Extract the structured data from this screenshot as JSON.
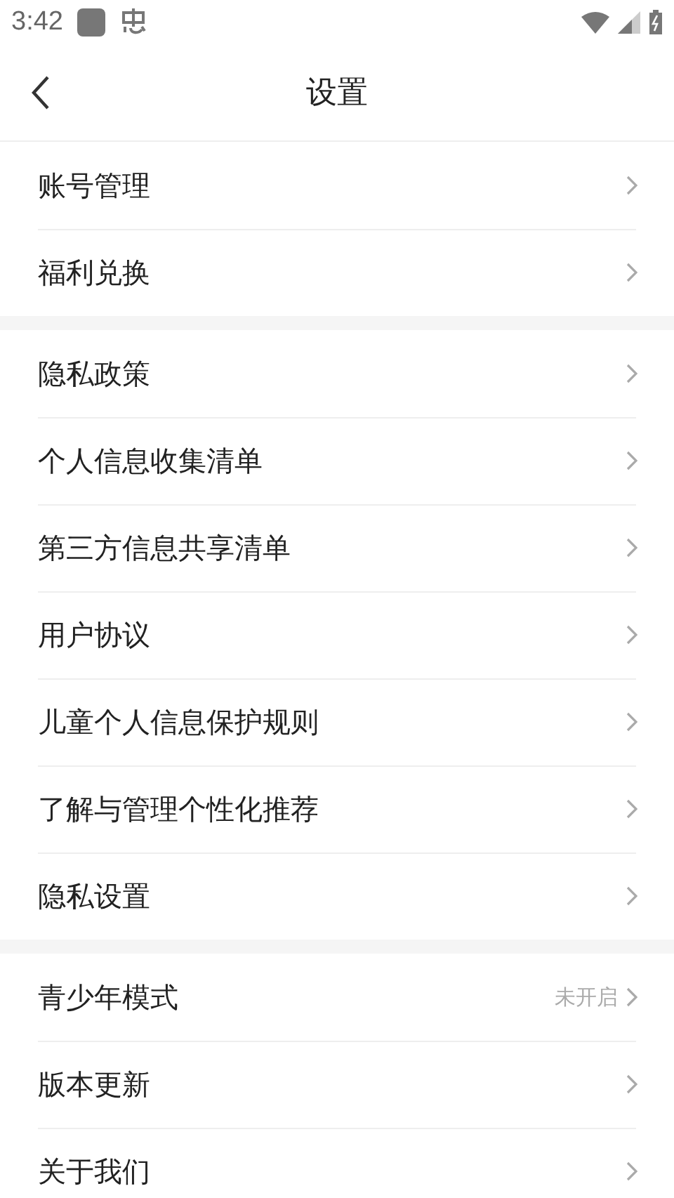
{
  "status_bar": {
    "time": "3:42"
  },
  "header": {
    "title": "设置"
  },
  "groups": [
    {
      "items": [
        {
          "label": "账号管理"
        },
        {
          "label": "福利兑换"
        }
      ]
    },
    {
      "items": [
        {
          "label": "隐私政策"
        },
        {
          "label": "个人信息收集清单"
        },
        {
          "label": "第三方信息共享清单"
        },
        {
          "label": "用户协议"
        },
        {
          "label": "儿童个人信息保护规则"
        },
        {
          "label": "了解与管理个性化推荐"
        },
        {
          "label": "隐私设置"
        }
      ]
    },
    {
      "items": [
        {
          "label": "青少年模式",
          "value": "未开启"
        },
        {
          "label": "版本更新"
        },
        {
          "label": "关于我们"
        }
      ]
    }
  ]
}
